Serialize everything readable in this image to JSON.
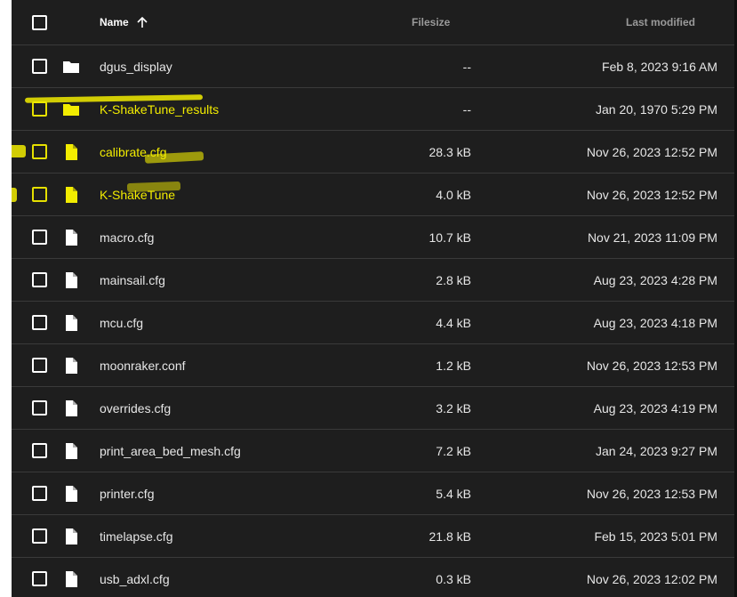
{
  "table": {
    "headers": {
      "name": "Name",
      "filesize": "Filesize",
      "last_modified": "Last modified"
    },
    "sort": {
      "column": "name",
      "direction": "ascending"
    },
    "rows": [
      {
        "type": "folder",
        "name": "dgus_display",
        "size": "--",
        "modified": "Feb 8, 2023 9:16 AM",
        "highlighted": false
      },
      {
        "type": "folder",
        "name": "K-ShakeTune_results",
        "size": "--",
        "modified": "Jan 20, 1970 5:29 PM",
        "highlighted": true
      },
      {
        "type": "file",
        "name": "calibrate.cfg",
        "size": "28.3 kB",
        "modified": "Nov 26, 2023 12:52 PM",
        "highlighted": true
      },
      {
        "type": "file",
        "name": "K-ShakeTune",
        "size": "4.0 kB",
        "modified": "Nov 26, 2023 12:52 PM",
        "highlighted": true
      },
      {
        "type": "file",
        "name": "macro.cfg",
        "size": "10.7 kB",
        "modified": "Nov 21, 2023 11:09 PM",
        "highlighted": false
      },
      {
        "type": "file",
        "name": "mainsail.cfg",
        "size": "2.8 kB",
        "modified": "Aug 23, 2023 4:28 PM",
        "highlighted": false
      },
      {
        "type": "file",
        "name": "mcu.cfg",
        "size": "4.4 kB",
        "modified": "Aug 23, 2023 4:18 PM",
        "highlighted": false
      },
      {
        "type": "file",
        "name": "moonraker.conf",
        "size": "1.2 kB",
        "modified": "Nov 26, 2023 12:53 PM",
        "highlighted": false
      },
      {
        "type": "file",
        "name": "overrides.cfg",
        "size": "3.2 kB",
        "modified": "Aug 23, 2023 4:19 PM",
        "highlighted": false
      },
      {
        "type": "file",
        "name": "print_area_bed_mesh.cfg",
        "size": "7.2 kB",
        "modified": "Jan 24, 2023 9:27 PM",
        "highlighted": false
      },
      {
        "type": "file",
        "name": "printer.cfg",
        "size": "5.4 kB",
        "modified": "Nov 26, 2023 12:53 PM",
        "highlighted": false
      },
      {
        "type": "file",
        "name": "timelapse.cfg",
        "size": "21.8 kB",
        "modified": "Feb 15, 2023 5:01 PM",
        "highlighted": false
      },
      {
        "type": "file",
        "name": "usb_adxl.cfg",
        "size": "0.3 kB",
        "modified": "Nov 26, 2023 12:02 PM",
        "highlighted": false
      }
    ]
  },
  "colors": {
    "background": "#1e1e1e",
    "text": "#e6e6e6",
    "highlight": "#f2ec00",
    "divider": "#3a3a3a"
  },
  "icons": {
    "folder": "folder-icon",
    "file": "file-icon",
    "sort": "arrow-up-icon",
    "checkbox": "checkbox-icon"
  }
}
